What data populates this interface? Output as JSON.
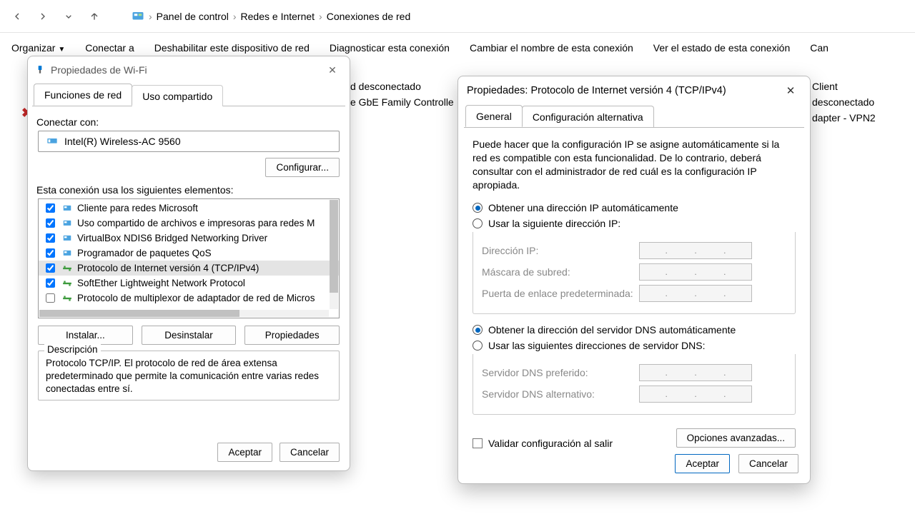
{
  "nav": {
    "crumb1": "Panel de control",
    "crumb2": "Redes e Internet",
    "crumb3": "Conexiones de red"
  },
  "toolbar": {
    "organize": "Organizar",
    "connect": "Conectar a",
    "disable": "Deshabilitar este dispositivo de red",
    "diagnose": "Diagnosticar esta conexión",
    "rename": "Cambiar el nombre de esta conexión",
    "status": "Ver el estado de esta conexión",
    "change": "Can"
  },
  "bg": {
    "a1": "d desconectado",
    "a2": "e GbE Family Controlle",
    "b1": "Client",
    "b2": "desconectado",
    "b3": "dapter - VPN2"
  },
  "wifi": {
    "title": "Propiedades de Wi-Fi",
    "tab1": "Funciones de red",
    "tab2": "Uso compartido",
    "connectWith": "Conectar con:",
    "adapter": "Intel(R) Wireless-AC 9560",
    "configure": "Configurar...",
    "usesLabel": "Esta conexión usa los siguientes elementos:",
    "items": [
      {
        "checked": true,
        "label": "Cliente para redes Microsoft"
      },
      {
        "checked": true,
        "label": "Uso compartido de archivos e impresoras para redes M"
      },
      {
        "checked": true,
        "label": "VirtualBox NDIS6 Bridged Networking Driver"
      },
      {
        "checked": true,
        "label": "Programador de paquetes QoS"
      },
      {
        "checked": true,
        "label": "Protocolo de Internet versión 4 (TCP/IPv4)"
      },
      {
        "checked": true,
        "label": "SoftEther Lightweight Network Protocol"
      },
      {
        "checked": false,
        "label": "Protocolo de multiplexor de adaptador de red de Micros"
      }
    ],
    "install": "Instalar...",
    "uninstall": "Desinstalar",
    "properties": "Propiedades",
    "descTitle": "Descripción",
    "descBody": "Protocolo TCP/IP. El protocolo de red de área extensa predeterminado que permite la comunicación entre varias redes conectadas entre sí.",
    "ok": "Aceptar",
    "cancel": "Cancelar"
  },
  "ip": {
    "title": "Propiedades: Protocolo de Internet versión 4 (TCP/IPv4)",
    "tab1": "General",
    "tab2": "Configuración alternativa",
    "explain": "Puede hacer que la configuración IP se asigne automáticamente si la red es compatible con esta funcionalidad. De lo contrario, deberá consultar con el administrador de red cuál es la configuración IP apropiada.",
    "autoIP": "Obtener una dirección IP automáticamente",
    "manualIP": "Usar la siguiente dirección IP:",
    "f_ip": "Dirección IP:",
    "f_mask": "Máscara de subred:",
    "f_gw": "Puerta de enlace predeterminada:",
    "autoDNS": "Obtener la dirección del servidor DNS automáticamente",
    "manualDNS": "Usar las siguientes direcciones de servidor DNS:",
    "f_dns1": "Servidor DNS preferido:",
    "f_dns2": "Servidor DNS alternativo:",
    "validate": "Validar configuración al salir",
    "advanced": "Opciones avanzadas...",
    "ok": "Aceptar",
    "cancel": "Cancelar"
  }
}
